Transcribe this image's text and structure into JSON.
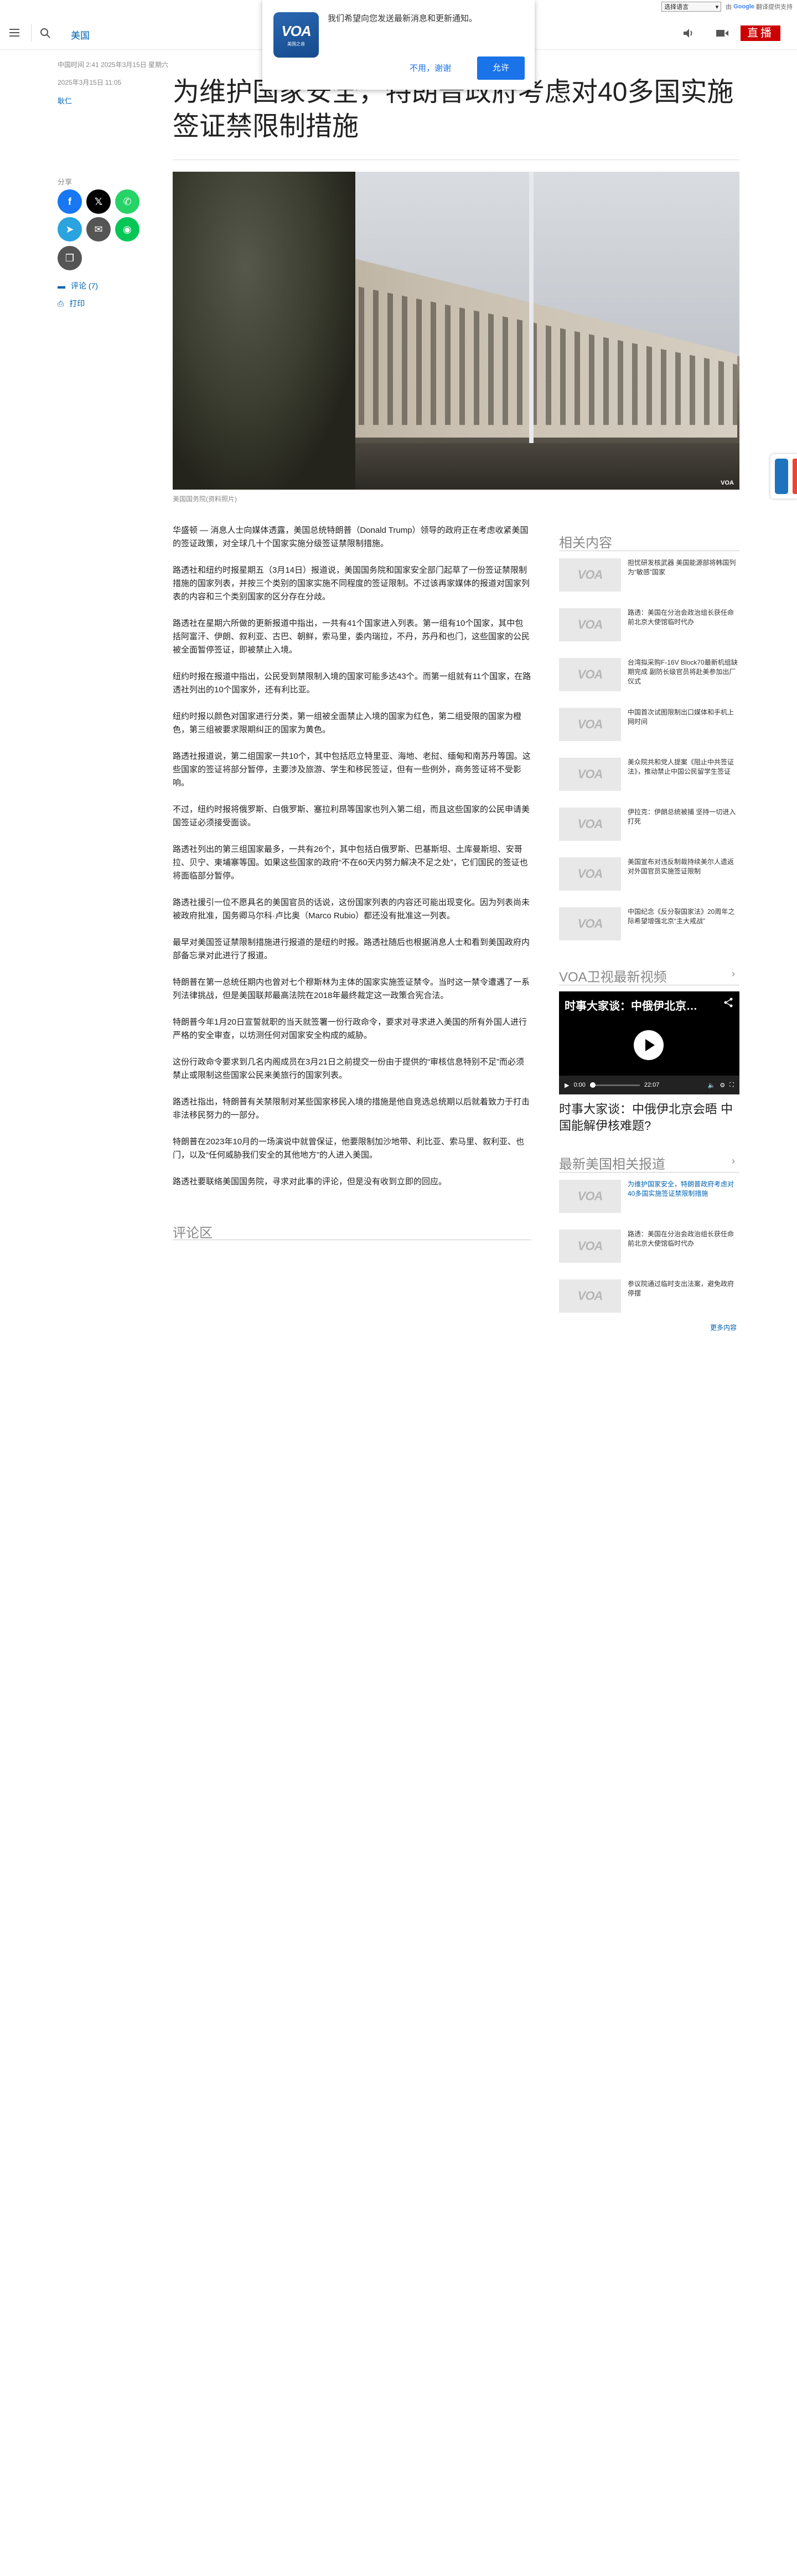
{
  "translate_bar": {
    "select_label": "选择语言",
    "powered": "由",
    "google": "Google",
    "service": "翻译提供支持"
  },
  "header": {
    "section": "美国",
    "live": "直播"
  },
  "notification": {
    "logo": "VOA",
    "logo_sub": "美国之音",
    "message": "我们希望向您发送最新消息和更新通知。",
    "decline": "不用，谢谢",
    "accept": "允许"
  },
  "article": {
    "published": "中国时间 2:41 2025年3月15日 星期六",
    "updated": "2025年3月15日 11:05",
    "author": "耿仁",
    "title": "为维护国家安全，特朗普政府考虑对40多国实施签证禁限制措施",
    "caption": "美国国务院(资料照片)",
    "image_watermark": "VOA",
    "paragraphs": [
      "华盛顿 — 消息人士向媒体透露，美国总统特朗普（Donald Trump）领导的政府正在考虑收紧美国的签证政策，对全球几十个国家实施分级签证禁限制措施。",
      "路透社和纽约时报星期五（3月14日）报道说，美国国务院和国家安全部门起草了一份签证禁限制措施的国家列表，并按三个类别的国家实施不同程度的签证限制。不过该再家媒体的报道对国家列表的内容和三个类别国家的区分存在分歧。",
      "路透社在星期六所做的更新报道中指出，一共有41个国家进入列表。第一组有10个国家，其中包括阿富汗、伊朗、叙利亚、古巴、朝鲜，索马里，委内瑞拉，不丹，苏丹和也门，这些国家的公民被全面暂停签证，即被禁止入境。",
      "纽约时报在报道中指出，公民受到禁限制入境的国家可能多达43个。而第一组就有11个国家，在路透社列出的10个国家外，还有利比亚。",
      "纽约时报以颜色对国家进行分类，第一组被全面禁止入境的国家为红色，第二组受限的国家为橙色，第三组被要求限期纠正的国家为黄色。",
      "路透社报道说，第二组国家一共10个，其中包括厄立特里亚、海地、老挝、缅甸和南苏丹等国。这些国家的签证将部分暂停，主要涉及旅游、学生和移民签证，但有一些例外，商务签证将不受影响。",
      "不过，纽约时报将俄罗斯、白俄罗斯、塞拉利昂等国家也列入第二组，而且这些国家的公民申请美国签证必须接受面谈。",
      "路透社列出的第三组国家最多，一共有26个，其中包括白俄罗斯、巴基斯坦、土库曼斯坦、安哥拉、贝宁、柬埔寨等国。如果这些国家的政府“不在60天内努力解决不足之处”，它们国民的签证也将面临部分暂停。",
      "路透社援引一位不愿具名的美国官员的话说，这份国家列表的内容还可能出现变化。因为列表尚未被政府批准，国务卿马尔科·卢比奥（Marco Rubio）都还没有批准这一列表。",
      "最早对美国签证禁限制措施进行报道的是纽约时报。路透社随后也根据消息人士和看到美国政府内部备忘录对此进行了报道。",
      "特朗普在第一总统任期内也曾对七个穆斯林为主体的国家实施签证禁令。当时这一禁令遭遇了一系列法律挑战，但是美国联邦最高法院在2018年最终裁定这一政策合宪合法。",
      "特朗普今年1月20日宣誓就职的当天就签署一份行政命令，要求对寻求进入美国的所有外国人进行严格的安全审查，以坊测任何对国家安全构成的威胁。",
      "这份行政命令要求到几名内阁成员在3月21日之前提交一份由于提供的“审核信息特别不足”而必须禁止或限制这些国家公民来美旅行的国家列表。",
      "路透社指出，特朗普有关禁限制对某些国家移民入境的措施是他自竞选总统期以后就着致力于打击非法移民努力的一部分。",
      "特朗普在2023年10月的一场演说中就曾保证，他要限制加沙地带、利比亚、索马里、叙利亚、也门，以及“任何威胁我们安全的其他地方”的人进入美国。",
      "路透社要联络美国国务院，寻求对此事的评论，但是没有收到立即的回应。"
    ]
  },
  "share": {
    "label": "分享",
    "comments": "评论 (7)",
    "print": "打印"
  },
  "comments_section": {
    "title": "评论区"
  },
  "sidebar": {
    "related_title": "相关内容",
    "related": [
      "担忧研发核武器 美国能源部将韩国列为“敏感”国家",
      "路透：美国在分治会政治组长获任命前北京大使馆临时代办",
      "台湾拟采购F-16V Block70最新机组缺期完成 副防长级官员将赴美参加出厂仪式",
      "中国首次试图限制出口媒体和手机上网时间",
      "美众院共和党人提案《阻止中共签证法》，推动禁止中国公民留学生签证",
      "伊拉克：伊朗总统被捕 坚持一切进入打死",
      "美国宣布对违反制裁持续美尔人遗返对外国官员实施签证限制",
      "中国纪念《反分裂国家法》20周年之际希望增强北京“主大戒战”"
    ],
    "video_section_title": "VOA卫视最新视频",
    "video": {
      "overlay_title": "时事大家谈：中俄伊北京…",
      "time_current": "0:00",
      "time_total": "22:07",
      "caption": "时事大家谈：中俄伊北京会晤 中国能解伊核难题?"
    },
    "latest_title": "最新美国相关报道",
    "latest": [
      "为维护国家安全，特朗普政府考虑对40多国实施签证禁限制措施",
      "路透：美国在分治会政治组长获任命前北京大使馆临时代办",
      "参议院通过临时支出法案，避免政府停摆"
    ],
    "more": "更多内容"
  }
}
